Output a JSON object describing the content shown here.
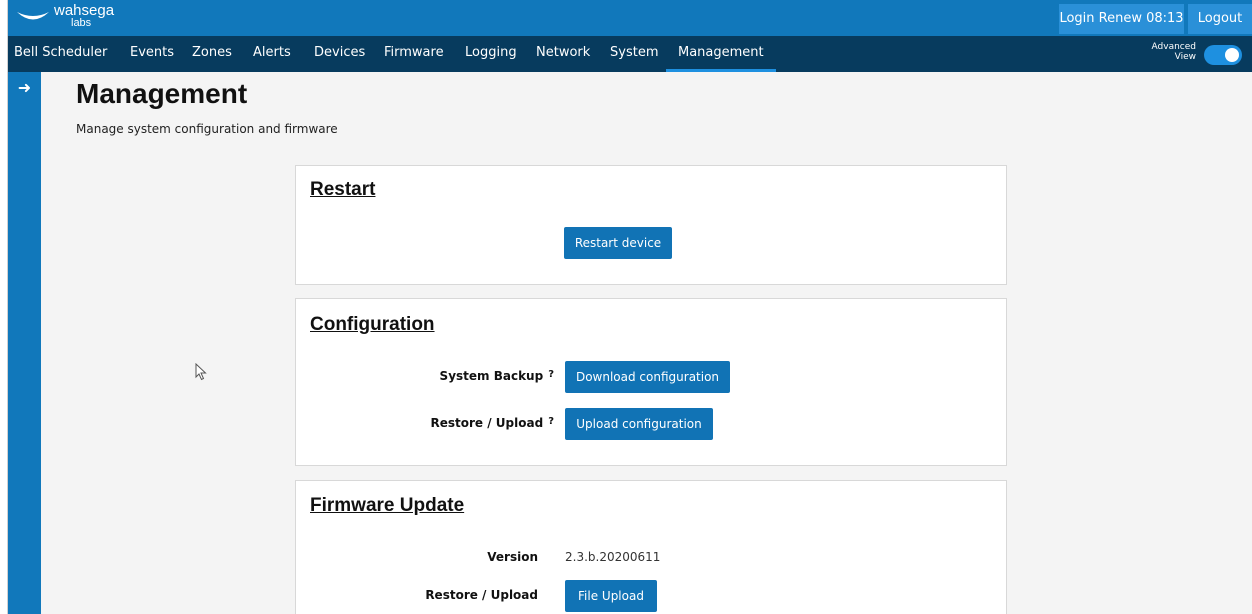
{
  "brand": {
    "name": "wahsega",
    "sub": "labs"
  },
  "header": {
    "login_renew": "Login Renew 08:13",
    "logout": "Logout"
  },
  "nav": {
    "items": [
      "Bell Scheduler",
      "Events",
      "Zones",
      "Alerts",
      "Devices",
      "Firmware",
      "Logging",
      "Network",
      "System",
      "Management"
    ],
    "active": "Management",
    "advanced_label_1": "Advanced",
    "advanced_label_2": "View",
    "advanced_view_on": true
  },
  "sidebar": {
    "toggle_icon": "arrow-right-icon"
  },
  "page": {
    "title": "Management",
    "subtitle": "Manage system configuration and firmware"
  },
  "restart": {
    "title": "Restart",
    "button": "Restart device"
  },
  "configuration": {
    "title": "Configuration",
    "backup_label": "System Backup",
    "backup_help": "?",
    "backup_button": "Download configuration",
    "restore_label": "Restore / Upload",
    "restore_help": "?",
    "restore_button": "Upload configuration"
  },
  "firmware": {
    "title": "Firmware Update",
    "version_label": "Version",
    "version_value": "2.3.b.20200611",
    "restore_label": "Restore / Upload",
    "upload_button": "File Upload"
  },
  "colors": {
    "topbar": "#1178bb",
    "navbar": "#073b5e",
    "button": "#1173b5",
    "accent": "#1e90e0"
  }
}
